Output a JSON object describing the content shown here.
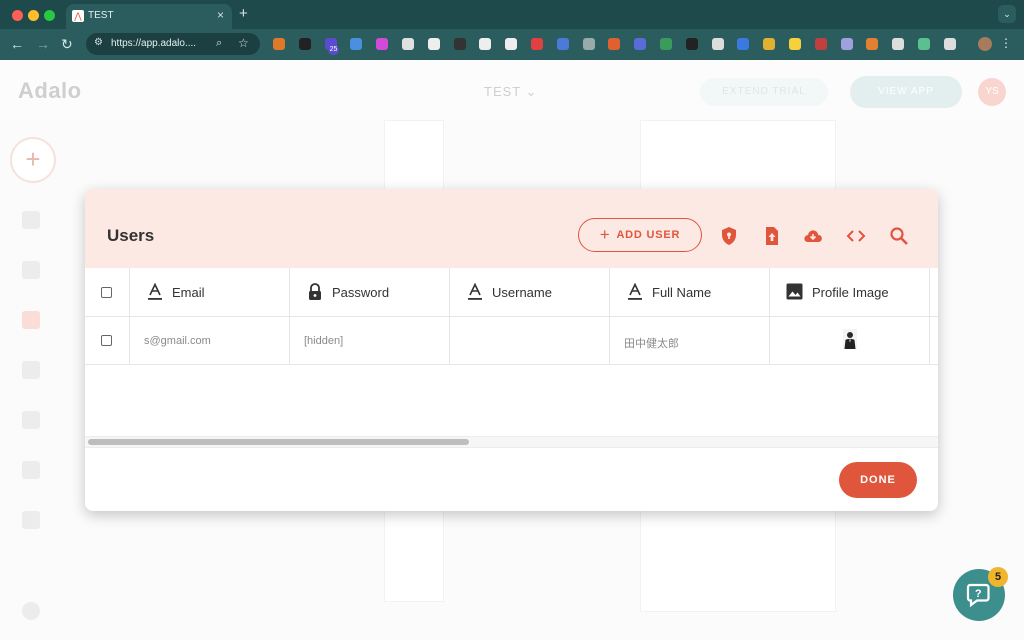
{
  "browser": {
    "tab_title": "TEST",
    "url": "https://app.adalo....",
    "ext_badge": "25",
    "extensions": [
      "#e0782a",
      "#222",
      "#5b4bcf",
      "#4a8fe0",
      "#d24ad8",
      "#e0e0e0",
      "#eee",
      "#333",
      "#eee",
      "#eee",
      "#e04040",
      "#4c7ad8",
      "#9aa",
      "#e06030",
      "#5b6bd8",
      "#3a9b5c",
      "#222",
      "#ddd",
      "#3a7ae0",
      "#e0b030",
      "#f5d23c",
      "#c04040",
      "#a0a0e0",
      "#e08030",
      "#ddd",
      "#5cbf8f",
      "#ddd"
    ]
  },
  "app": {
    "logo": "Adalo",
    "project": "TEST",
    "extend_trial": "EXTEND TRIAL",
    "view_app": "VIEW APP",
    "user_initials": "YS"
  },
  "modal": {
    "title": "Users",
    "add_user_label": "ADD USER",
    "done_label": "DONE",
    "columns": [
      {
        "label": "Email",
        "icon": "text-field-icon"
      },
      {
        "label": "Password",
        "icon": "lock-icon"
      },
      {
        "label": "Username",
        "icon": "text-field-icon"
      },
      {
        "label": "Full Name",
        "icon": "text-field-icon"
      },
      {
        "label": "Profile Image",
        "icon": "image-icon"
      }
    ],
    "rows": [
      {
        "email": "s@gmail.com",
        "password": "[hidden]",
        "username": "",
        "full_name": "田中健太郎",
        "profile_image": "profile-thumbnail"
      }
    ]
  },
  "help": {
    "badge_count": "5"
  },
  "colors": {
    "accent": "#e0563c",
    "header_bg": "#fde9e4",
    "browser_chrome": "#2b5d5e",
    "help": "#3c8f8c"
  }
}
